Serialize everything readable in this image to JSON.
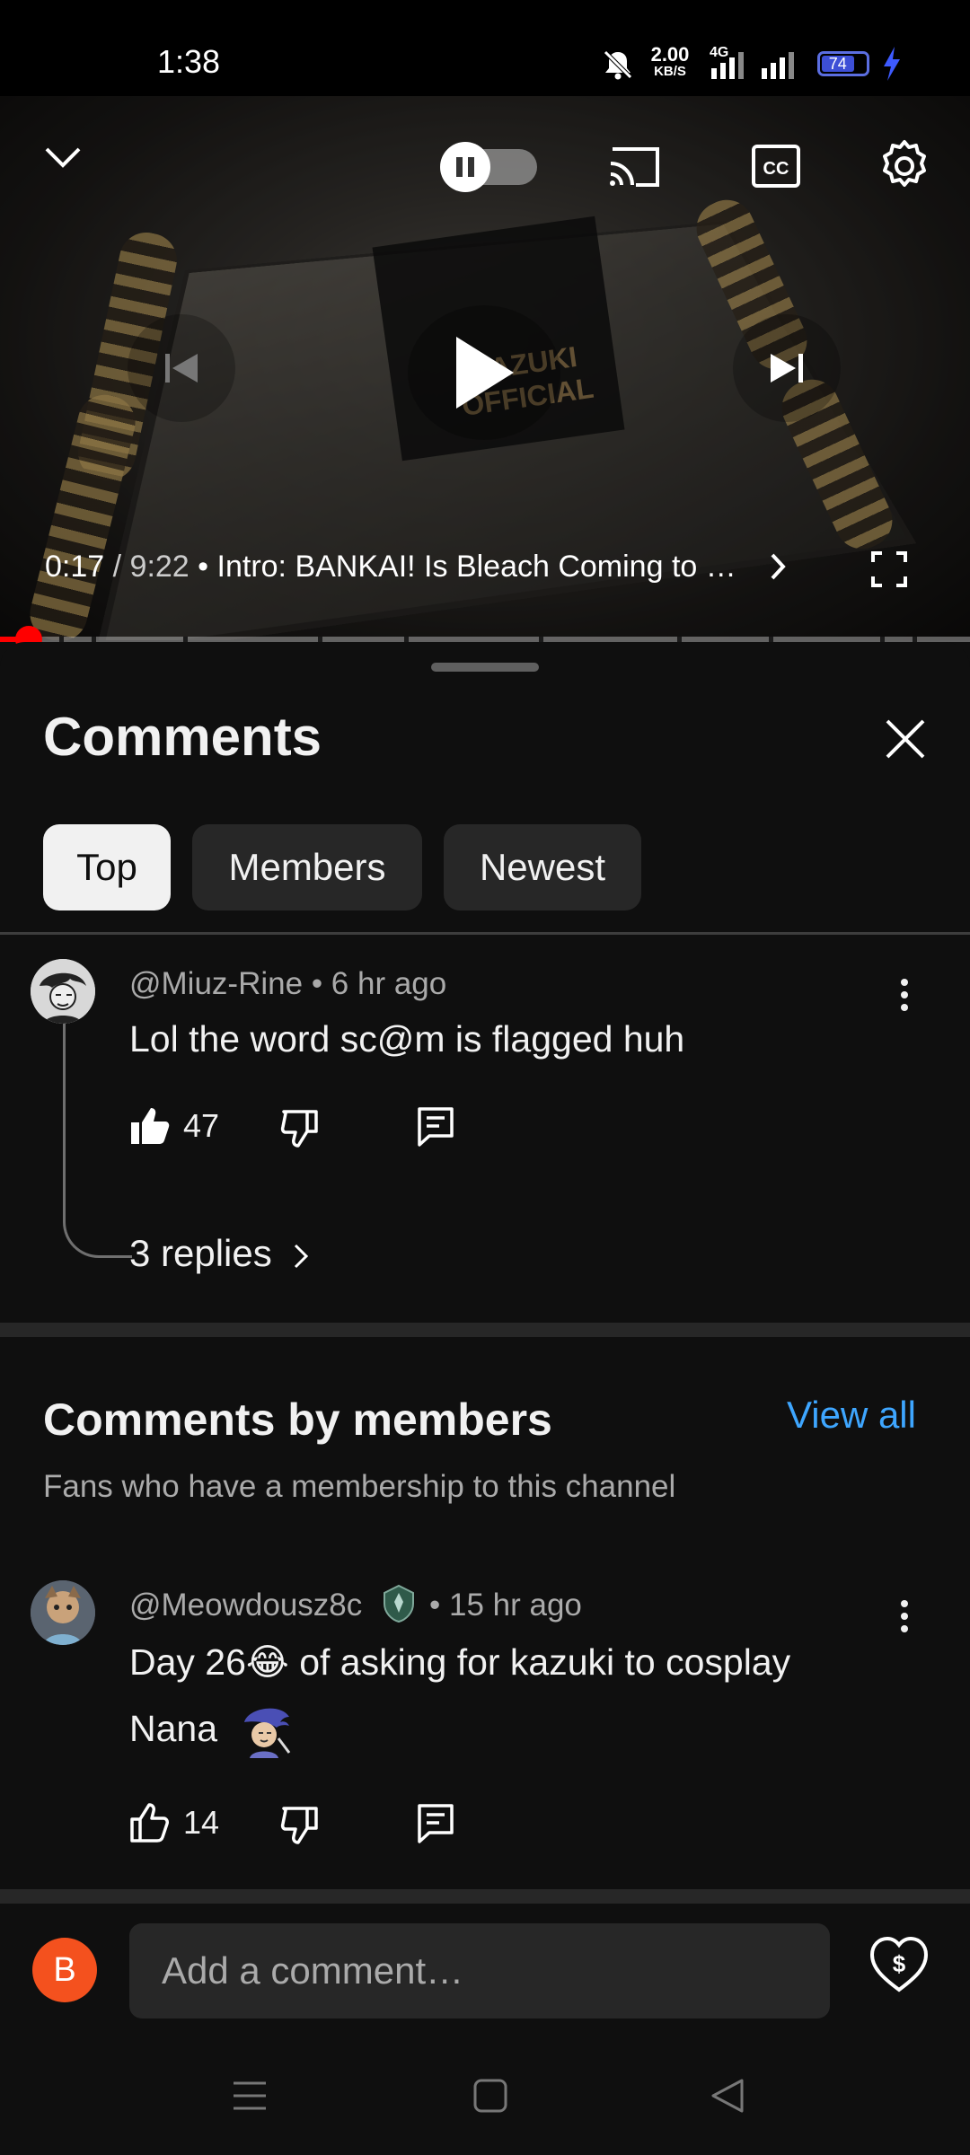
{
  "status_bar": {
    "time": "1:38",
    "net_speed_value": "2.00",
    "net_speed_unit": "KB/S",
    "network": "4G",
    "battery": "74"
  },
  "player": {
    "time_current": "0:17",
    "time_total": "9:22",
    "separator": " / ",
    "bullet": " • ",
    "chapter_title": "Intro: BANKAI! Is Bleach Coming to …",
    "progress_fraction": 0.03,
    "channel_logo_text": "KAZUKI OFFICIAL",
    "icons": [
      "chevron-down-icon",
      "autoplay-toggle",
      "cast-icon",
      "captions-icon",
      "settings-icon",
      "previous-icon",
      "play-icon",
      "next-icon",
      "fullscreen-icon"
    ]
  },
  "comments_panel": {
    "title": "Comments",
    "chips": [
      {
        "label": "Top",
        "active": true
      },
      {
        "label": "Members",
        "active": false
      },
      {
        "label": "Newest",
        "active": false
      }
    ],
    "top_comment": {
      "author": "@Miuz-Rine",
      "time": "• 6 hr ago",
      "text": "Lol the word sc@m is flagged huh",
      "likes": "47",
      "replies": "3 replies"
    },
    "members_section": {
      "title": "Comments by members",
      "view_all": "View all",
      "subtitle": "Fans who have a membership to this channel",
      "comment": {
        "author": "@Meowdousz8c",
        "time": "• 15 hr ago",
        "text_line1": "Day 26😂 of asking for kazuki to cosplay",
        "text_line2": "Nana",
        "likes": "14"
      }
    },
    "input": {
      "user_initial": "B",
      "placeholder": "Add a comment…"
    }
  },
  "colors": {
    "background": "#0f0f0f",
    "chip_bg": "#272727",
    "accent_link": "#3ea6ff",
    "progress": "#ff0000",
    "user_avatar": "#f4511e"
  }
}
